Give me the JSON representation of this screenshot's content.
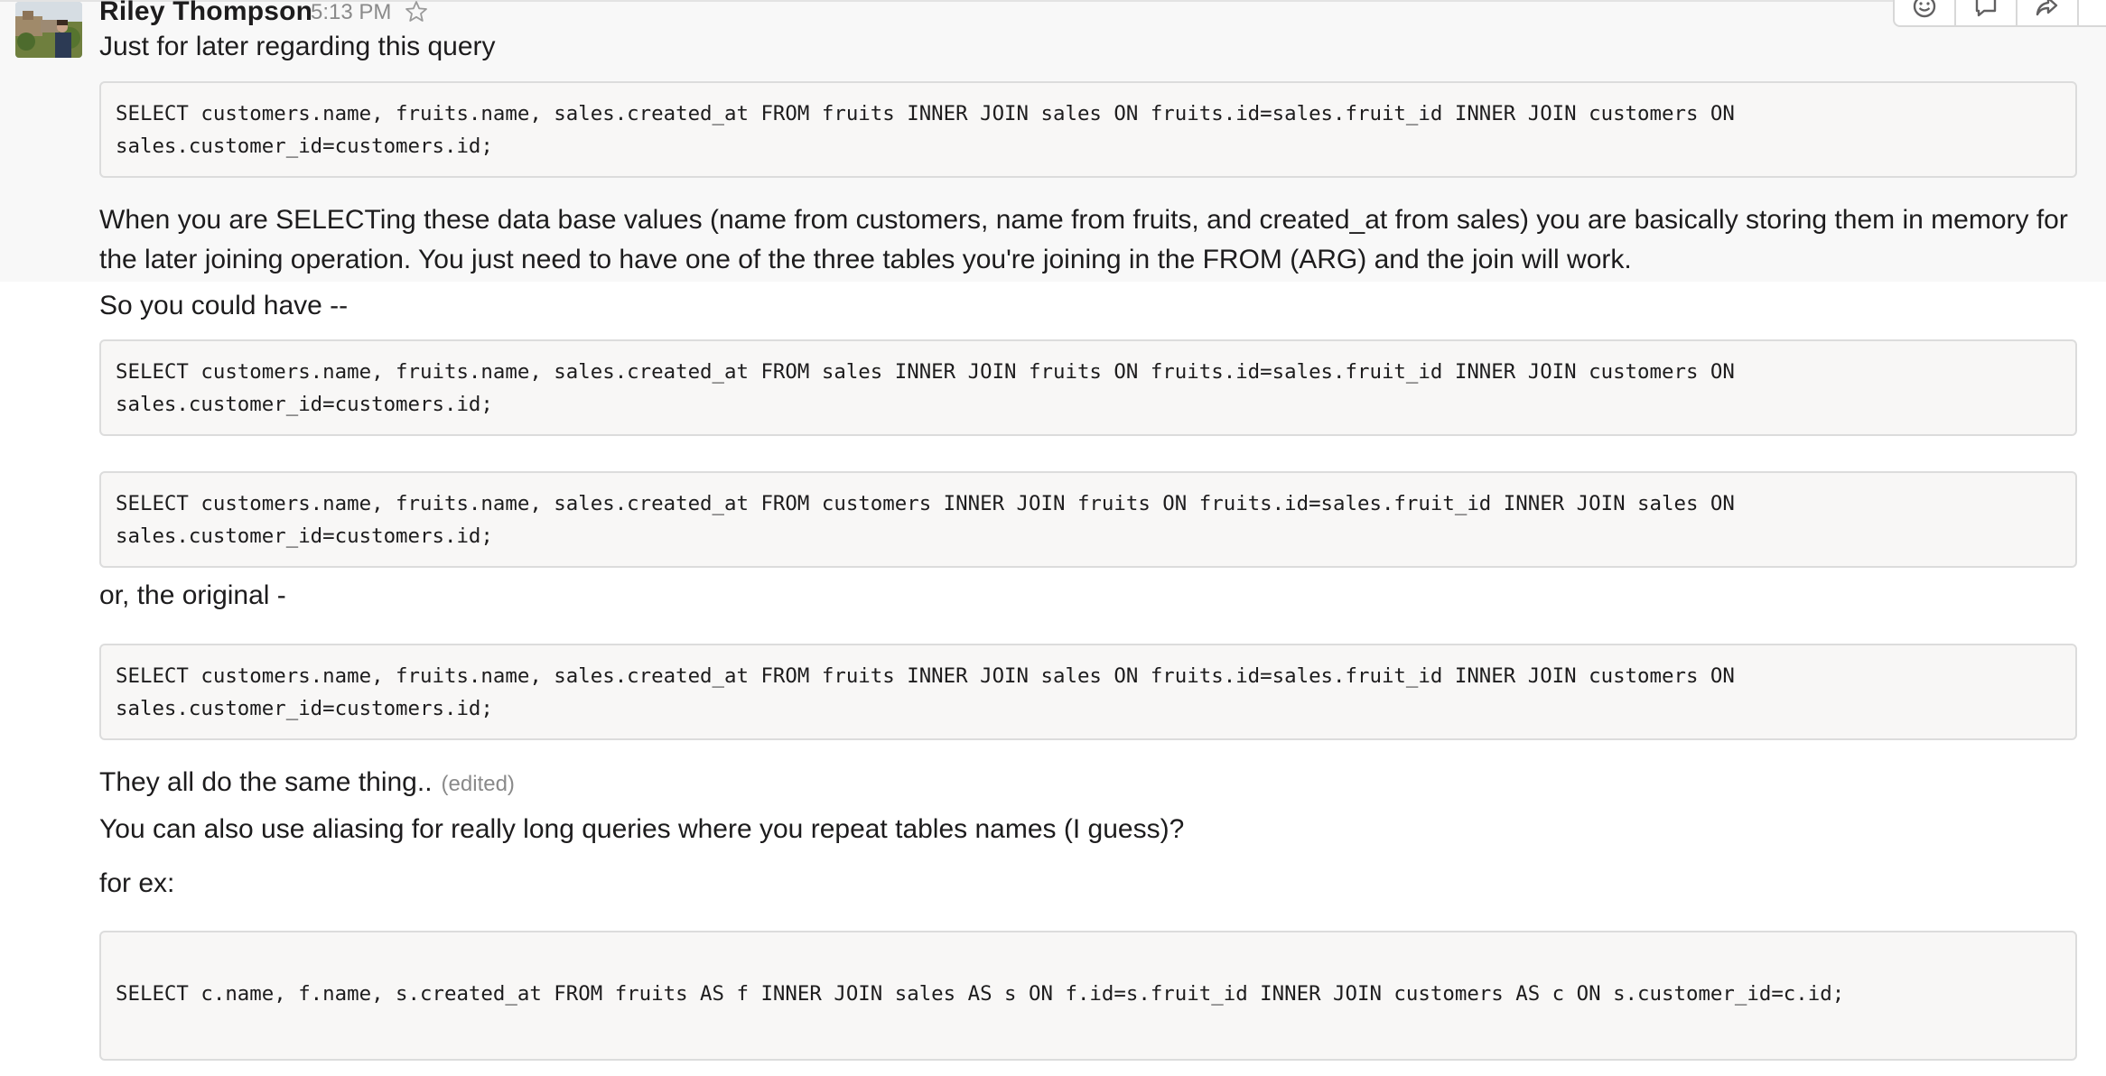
{
  "message": {
    "sender": "Riley Thompson",
    "time": "5:13 PM"
  },
  "lines": {
    "intro": "Just for later regarding this query",
    "explanation": "When you are SELECTing these data base values (name from customers, name from fruits, and created_at from sales) you are basically storing them in memory for the later joining operation. You just need to have one of the three tables you're joining in the FROM (ARG) and the join will work.",
    "so_you_could": "So you could have --",
    "or_original": "or, the original -",
    "same_thing": "They all do the same thing..",
    "edited": "(edited)",
    "aliasing": "You can also use aliasing for really long queries where you repeat tables names (I guess)?",
    "for_ex": "for ex:"
  },
  "code_blocks": [
    {
      "line1": "SELECT customers.name, fruits.name, sales.created_at FROM fruits INNER JOIN sales ON fruits.id=sales.fruit_id INNER JOIN customers ON",
      "line2": "sales.customer_id=customers.id;"
    },
    {
      "line1": "SELECT customers.name, fruits.name, sales.created_at FROM sales INNER JOIN fruits ON fruits.id=sales.fruit_id INNER JOIN customers ON",
      "line2": "sales.customer_id=customers.id;"
    },
    {
      "line1": "SELECT customers.name, fruits.name, sales.created_at FROM customers INNER JOIN fruits ON fruits.id=sales.fruit_id INNER JOIN sales ON",
      "line2": "sales.customer_id=customers.id;"
    },
    {
      "line1": "SELECT customers.name, fruits.name, sales.created_at FROM fruits INNER JOIN sales ON fruits.id=sales.fruit_id INNER JOIN customers ON",
      "line2": "sales.customer_id=customers.id;"
    },
    {
      "line1": "SELECT c.name, f.name, s.created_at FROM fruits AS f INNER JOIN sales AS s ON f.id=s.fruit_id INNER JOIN customers AS c ON s.customer_id=c.id;"
    }
  ],
  "toolbar": {
    "icons": [
      "add-reaction-icon",
      "reply-thread-icon",
      "share-message-icon"
    ]
  },
  "icons": {
    "star": "star-icon",
    "avatar": "avatar"
  }
}
